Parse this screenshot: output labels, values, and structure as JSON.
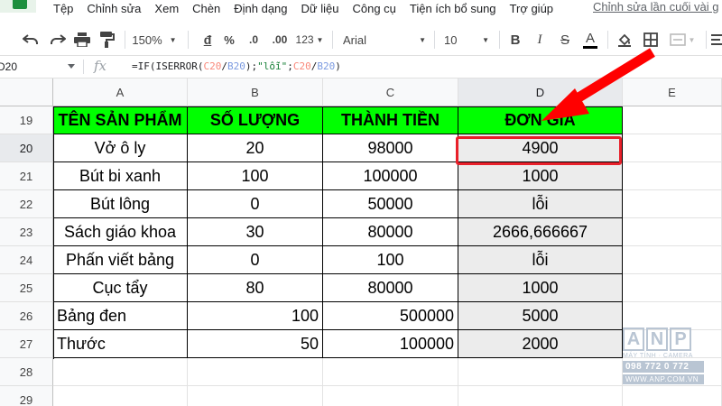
{
  "menu": {
    "items": [
      "Tệp",
      "Chỉnh sửa",
      "Xem",
      "Chèn",
      "Định dạng",
      "Dữ liệu",
      "Công cụ",
      "Tiện ích bổ sung",
      "Trợ giúp"
    ],
    "last_edit": "Chỉnh sửa lần cuối vài g"
  },
  "toolbar": {
    "zoom": "150%",
    "currency": "đ",
    "percent": "%",
    "dec_decrease": ".0",
    "dec_increase": ".00",
    "more_formats": "123",
    "font": "Arial",
    "font_size": "10",
    "bold": "B",
    "italic": "I",
    "strike": "S",
    "text_color": "A",
    "text_color_hex": "#000000"
  },
  "formula_bar": {
    "name_box": "D20",
    "fx": "fx",
    "f_prefix": "=IF(ISERROR(",
    "f_ref1": "C20",
    "f_div1": "/",
    "f_ref2": "B20",
    "f_mid": ");",
    "f_str": "\"lỗi\"",
    "f_semi": ";",
    "f_ref3": "C20",
    "f_div2": "/",
    "f_ref4": "B20",
    "f_end": ")"
  },
  "sheet": {
    "columns": [
      "A",
      "B",
      "C",
      "D",
      "E"
    ],
    "rows": [
      "19",
      "20",
      "21",
      "22",
      "23",
      "24",
      "25",
      "26",
      "27",
      "28",
      "29"
    ],
    "header": [
      "TÊN SẢN PHẨM",
      "SỐ LƯỢNG",
      "THÀNH TIỀN",
      "ĐƠN GIÁ"
    ],
    "data": [
      [
        "Vở ô ly",
        "20",
        "98000",
        "4900"
      ],
      [
        "Bút bi xanh",
        "100",
        "100000",
        "1000"
      ],
      [
        "Bút lông",
        "0",
        "50000",
        "lỗi"
      ],
      [
        "Sách giáo khoa",
        "30",
        "80000",
        "2666,666667"
      ],
      [
        "Phấn viết bảng",
        "0",
        "100",
        "lỗi"
      ],
      [
        "Cục tẩy",
        "80",
        "80000",
        "1000"
      ],
      [
        "Bảng đen",
        "100",
        "500000",
        "5000"
      ],
      [
        "Thước",
        "50",
        "100000",
        "2000"
      ]
    ],
    "header_color": "#00ff00",
    "highlight_color": "#e8202a"
  },
  "watermark": {
    "letters": [
      "A",
      "N",
      "P"
    ],
    "subtitle": "MÁY TÍNH · CAMERA",
    "phone": "098 772 0 772",
    "url": "WWW.ANP.COM.VN"
  }
}
